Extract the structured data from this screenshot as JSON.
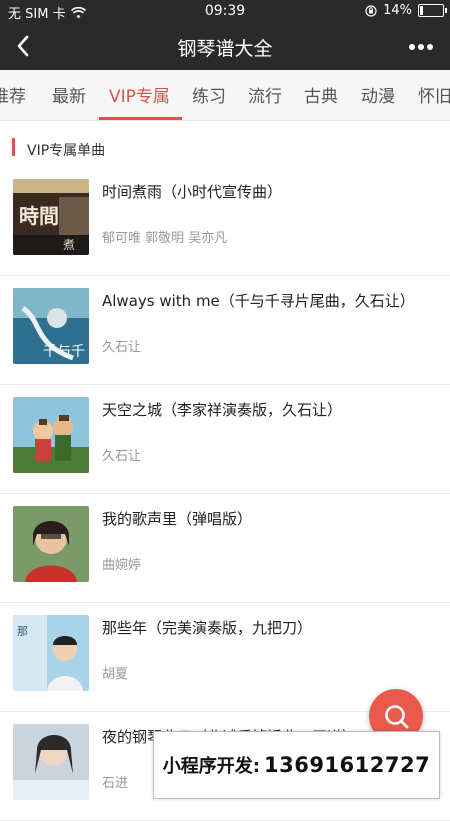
{
  "status_bar": {
    "carrier": "无 SIM 卡",
    "time": "09:39",
    "battery_percent": "14%",
    "battery_level": 0.14
  },
  "nav": {
    "title": "钢琴谱大全",
    "back_icon": "chevron-left-icon",
    "more_icon": "more-dots-icon"
  },
  "tabs": [
    {
      "label": "推荐",
      "active": false
    },
    {
      "label": "最新",
      "active": false
    },
    {
      "label": "VIP专属",
      "active": true
    },
    {
      "label": "练习",
      "active": false
    },
    {
      "label": "流行",
      "active": false
    },
    {
      "label": "古典",
      "active": false
    },
    {
      "label": "动漫",
      "active": false
    },
    {
      "label": "怀旧",
      "active": false
    }
  ],
  "section": {
    "title": "VIP专属单曲"
  },
  "songs": [
    {
      "title": "时间煮雨（小时代宣传曲）",
      "artist": "郁可唯  郭敬明  吴亦凡",
      "cover_text": "時間"
    },
    {
      "title": "Always with me（千与千寻片尾曲，久石让）",
      "artist": "久石让",
      "cover_text": "千与千"
    },
    {
      "title": "天空之城（李家祥演奏版，久石让）",
      "artist": "久石让",
      "cover_text": ""
    },
    {
      "title": "我的歌声里（弹唱版）",
      "artist": "曲婉婷",
      "cover_text": ""
    },
    {
      "title": "那些年（完美演奏版，九把刀）",
      "artist": "胡夏",
      "cover_text": ""
    },
    {
      "title": "夜的钢琴曲五（北诚乐掉插曲，正谱）",
      "artist": "石进",
      "cover_text": ""
    }
  ],
  "fab": {
    "icon": "search-icon"
  },
  "watermark": {
    "label": "小程序开发:",
    "phone": "13691612727"
  },
  "colors": {
    "accent": "#d9534f",
    "header_bg": "#2a2a2a",
    "fab": "#ea5a4c"
  }
}
